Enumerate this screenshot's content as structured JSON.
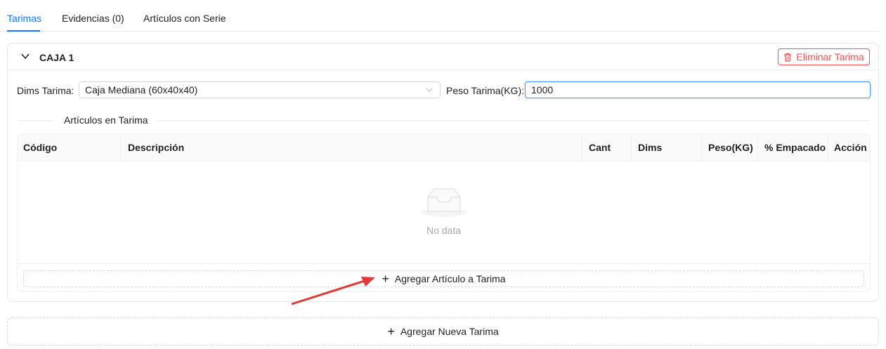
{
  "tabs": [
    {
      "label": "Tarimas",
      "active": true
    },
    {
      "label": "Evidencias (0)",
      "active": false
    },
    {
      "label": "Artículos con Serie",
      "active": false
    }
  ],
  "card": {
    "title": "CAJA 1",
    "delete_button": "Eliminar Tarima",
    "dims_label": "Dims Tarima",
    "dims_value": "Caja Mediana (60x40x40)",
    "peso_label": "Peso Tarima(KG)",
    "peso_value": "1000",
    "section_title": "Artículos en Tarima"
  },
  "table": {
    "columns": [
      "Código",
      "Descripción",
      "Cant",
      "Dims",
      "Peso(KG)",
      "% Empacado",
      "Acción"
    ],
    "empty_text": "No data",
    "add_row_label": "Agregar Artículo a Tarima"
  },
  "add_tarima_label": "Agregar Nueva Tarima",
  "colors": {
    "accent": "#1677ff",
    "danger": "#ff4d4f",
    "annotation_arrow": "#e53935"
  },
  "icons": {
    "collapse": "chevron-down-icon",
    "delete": "trash-icon",
    "select": "chevron-down-icon",
    "empty": "empty-inbox-icon",
    "add": "plus-icon"
  }
}
